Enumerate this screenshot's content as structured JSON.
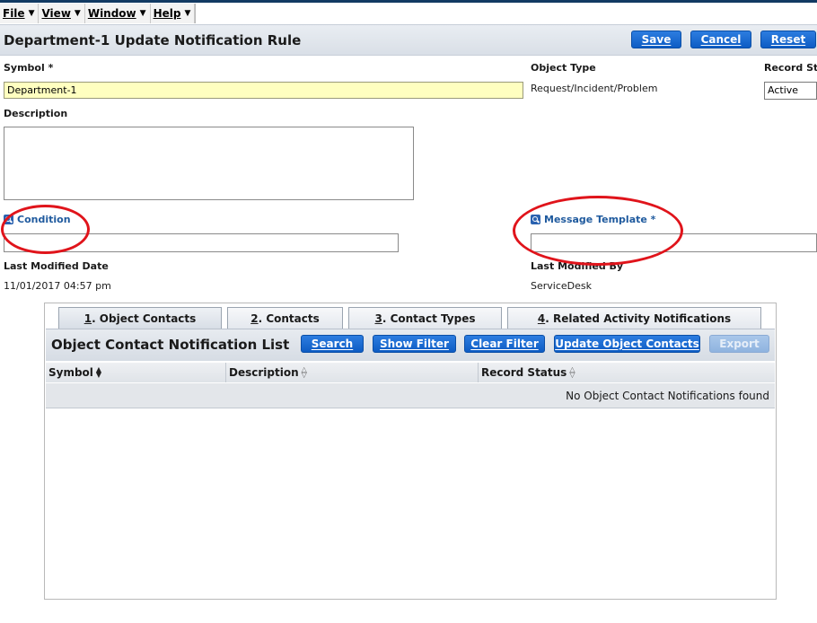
{
  "menu": [
    {
      "label": "File"
    },
    {
      "label": "View"
    },
    {
      "label": "Window"
    },
    {
      "label": "Help"
    }
  ],
  "header": {
    "title": "Department-1 Update Notification Rule",
    "buttons": {
      "save": "Save",
      "cancel": "Cancel",
      "reset": "Reset"
    }
  },
  "form": {
    "symbol_label": "Symbol *",
    "symbol_value": "Department-1",
    "object_type_label": "Object Type",
    "object_type_value": "Request/Incident/Problem",
    "record_status_label": "Record St",
    "record_status_value": "Active",
    "description_label": "Description",
    "description_value": "",
    "condition_label": "Condition",
    "condition_value": "",
    "message_template_label": "Message Template *",
    "message_template_value": "",
    "last_modified_date_label": "Last Modified Date",
    "last_modified_date_value": "11/01/2017 04:57 pm",
    "last_modified_by_label": "Last Modified By",
    "last_modified_by_value": "ServiceDesk"
  },
  "tabs": [
    {
      "num": "1",
      "text": ". Object Contacts"
    },
    {
      "num": "2",
      "text": ". Contacts"
    },
    {
      "num": "3",
      "text": ". Contact Types"
    },
    {
      "num": "4",
      "text": ". Related Activity Notifications"
    }
  ],
  "list": {
    "title": "Object Contact Notification List",
    "buttons": {
      "search": "Search",
      "show_filter": "Show Filter",
      "clear_filter": "Clear Filter",
      "update_contacts": "Update Object Contacts",
      "export": "Export"
    },
    "columns": [
      "Symbol",
      "Description",
      "Record Status"
    ],
    "empty_message": "No Object Contact Notifications found"
  },
  "colors": {
    "button_blue": "#0d5cc4",
    "link_blue": "#1f5a9e",
    "highlight_input": "#ffffc0",
    "annotation_red": "#e0141b"
  }
}
